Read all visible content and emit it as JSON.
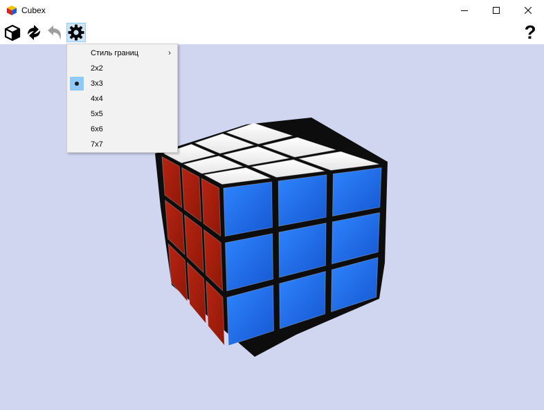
{
  "app": {
    "title": "Cubex"
  },
  "window_controls": {
    "minimize_icon": "minimize-icon",
    "maximize_icon": "maximize-icon",
    "close_icon": "close-icon"
  },
  "toolbar": {
    "tools": [
      {
        "name": "new-cube-button",
        "icon": "cube-icon"
      },
      {
        "name": "scramble-button",
        "icon": "scramble-arrows-icon"
      },
      {
        "name": "undo-button",
        "icon": "undo-icon",
        "disabled": true
      },
      {
        "name": "settings-button",
        "icon": "gear-icon",
        "active": true
      }
    ],
    "help_label": "?"
  },
  "menu": {
    "items": [
      {
        "label": "Стиль границ",
        "submenu": true
      },
      {
        "label": "2x2",
        "checked": false
      },
      {
        "label": "3x3",
        "checked": true
      },
      {
        "label": "4x4",
        "checked": false
      },
      {
        "label": "5x5",
        "checked": false
      },
      {
        "label": "6x6",
        "checked": false
      },
      {
        "label": "7x7",
        "checked": false
      }
    ]
  },
  "cube": {
    "size": 3,
    "colors": {
      "top": "#ffffff",
      "front": "#1e6ff0",
      "left": "#a31d0e",
      "body": "#111111",
      "background": "#d0d6f0"
    }
  }
}
